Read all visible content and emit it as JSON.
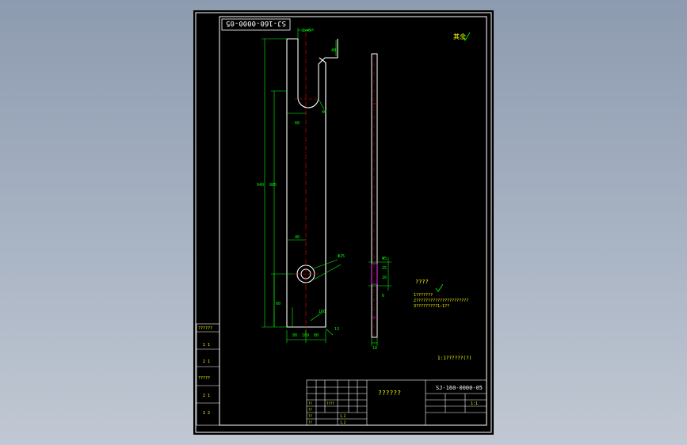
{
  "drawing_number_rotated": "SJ-160-0000-05",
  "drawing_number": "SJ-160-0000-05",
  "surface_mark_top": "其余",
  "dim_chamfer_top": "2x45°",
  "dim_labels": [
    "40",
    "60",
    "40",
    "40",
    "60",
    "940",
    "865",
    "160",
    "80",
    "80",
    "160",
    "13"
  ],
  "thickness_dim": "18",
  "thickness_dims": [
    "Φ5",
    "25",
    "16",
    "6"
  ],
  "hole_note": "Φ25",
  "tech_title": "????",
  "tech_lines": [
    "1???????",
    "2??????????????????????",
    "3?????????1:1??"
  ],
  "tech_note_bottom": "1:1??????(?)",
  "title_block_name": "??????",
  "title_block_small": [
    "??",
    "??",
    "????",
    "??",
    "??"
  ],
  "title_block_grid_labels": [
    "1.2",
    "1.2",
    "1:1"
  ],
  "left_strip_labels": [
    "??????",
    "1 1",
    "2 1",
    "?????",
    "2 1",
    "2 2"
  ],
  "colors": {
    "paper": "#000000",
    "outline": "#ffffff",
    "dim": "#00ff00",
    "center": "#ff0000",
    "text": "#ffff00",
    "hatch": "#ff00ff"
  }
}
